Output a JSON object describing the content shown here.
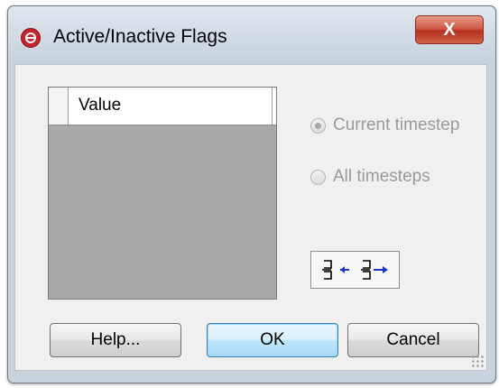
{
  "window": {
    "title": "Active/Inactive Flags",
    "close_label": "X"
  },
  "grid": {
    "columns": [
      "",
      "Value"
    ],
    "rows": []
  },
  "options": {
    "current_timestep_label": "Current timestep",
    "all_timesteps_label": "All timesteps",
    "selected": "current_timestep",
    "enabled": false
  },
  "tools": {
    "left_icon": "move-left-icon",
    "right_icon": "move-right-icon"
  },
  "buttons": {
    "help_label": "Help...",
    "ok_label": "OK",
    "cancel_label": "Cancel"
  },
  "colors": {
    "title_icon": "#c4232b",
    "close_button": "#c8432f",
    "grid_body": "#a9a9a9",
    "ok_button": "#bee6fd",
    "disabled_text": "#9a9a9a"
  }
}
